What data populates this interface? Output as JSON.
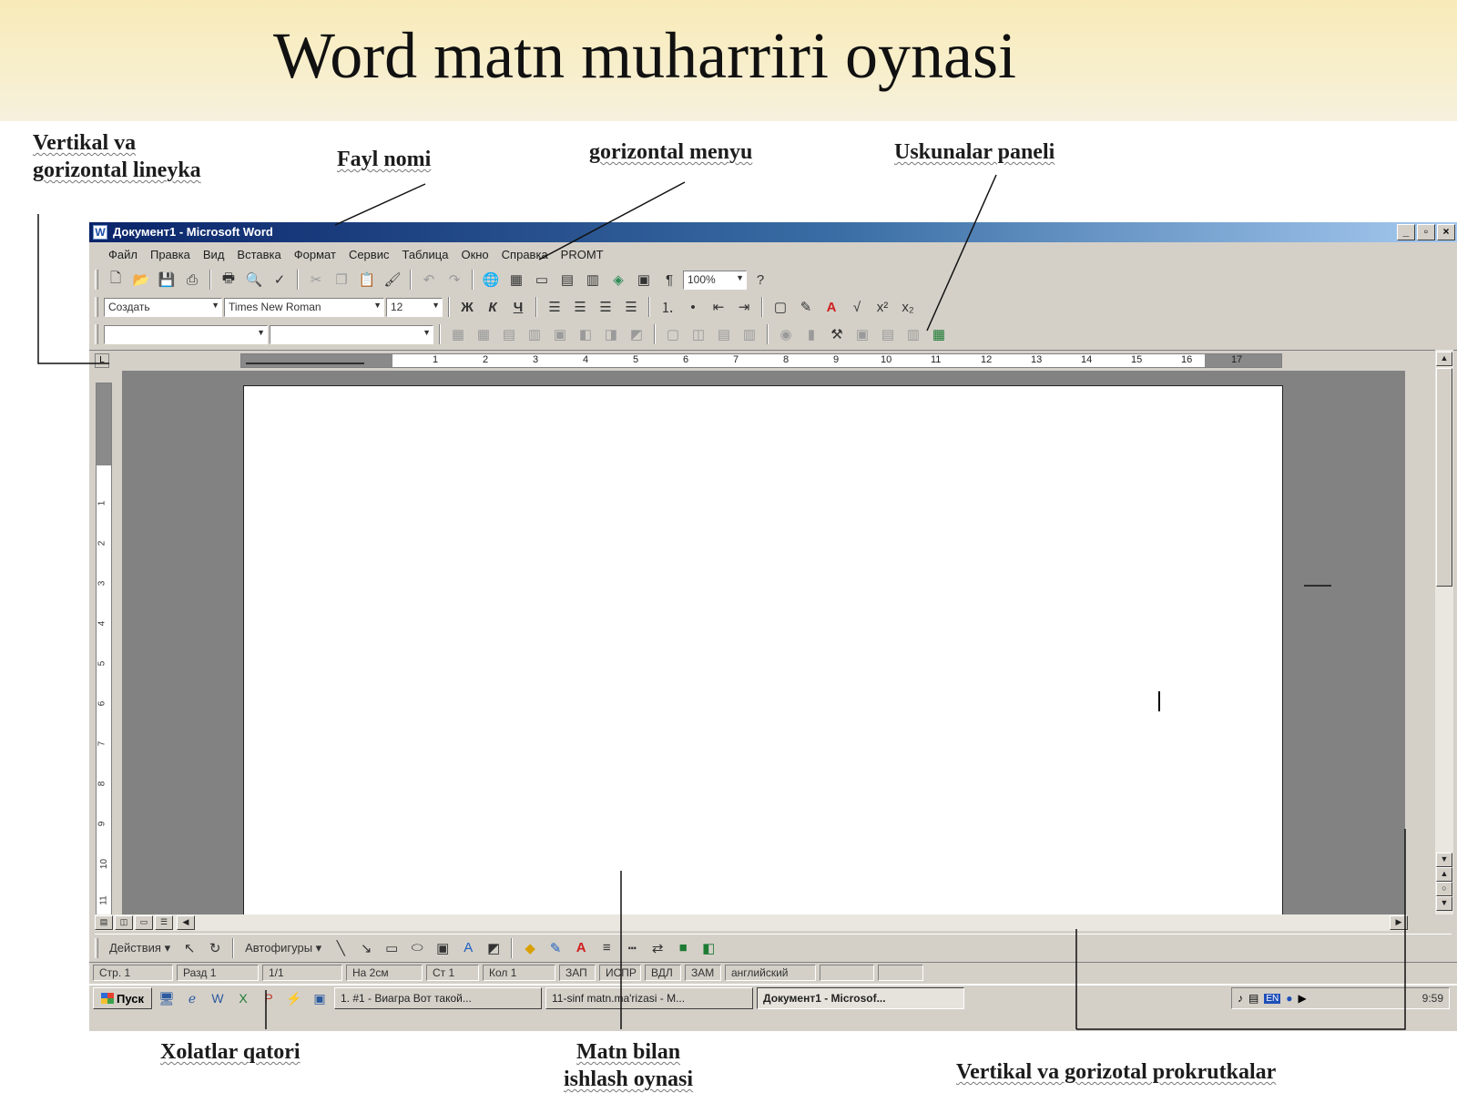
{
  "slide": {
    "title": "Word matn muharriri oynasi"
  },
  "callouts": {
    "rulers": "Vertikal va\ngorizontal lineyka",
    "file_name": "Fayl nomi",
    "menu": "gorizontal menyu",
    "toolbar": "Uskunalar paneli",
    "status": "Xolatlar  qatori",
    "text_area": "Matn bilan\nishlash oynasi",
    "scrollbars": "Vertikal va gorizotal prokrutkalar"
  },
  "window": {
    "title": "Документ1 - Microsoft Word",
    "controls": [
      "_",
      "▫",
      "×"
    ]
  },
  "menu": [
    "Файл",
    "Правка",
    "Вид",
    "Вставка",
    "Формат",
    "Сервис",
    "Таблица",
    "Окно",
    "Справка",
    "PROMT"
  ],
  "format_bar": {
    "style": "Создать",
    "font": "Times New Roman",
    "size": "12"
  },
  "standard_bar": {
    "zoom": "100%"
  },
  "ruler_numbers": [
    "1",
    "2",
    "3",
    "4",
    "5",
    "6",
    "7",
    "8",
    "9",
    "10",
    "11",
    "12",
    "13",
    "14",
    "15",
    "16",
    "17"
  ],
  "vruler_numbers": [
    "1",
    "2",
    "3",
    "4",
    "5",
    "6",
    "7",
    "8",
    "9",
    "10",
    "11"
  ],
  "drawing_bar": {
    "actions": "Действия ▾",
    "autoshapes": "Автофигуры ▾"
  },
  "status_bar": {
    "page": "Стр.  1",
    "section": "Разд  1",
    "pages": "1/1",
    "at": "На  2см",
    "line": "Ст  1",
    "col": "Кол  1",
    "rec": "ЗАП",
    "trk": "ИСПР",
    "ext": "ВДЛ",
    "ovr": "ЗАМ",
    "language": "английский"
  },
  "taskbar": {
    "start": "Пуск",
    "tasks": [
      "1. #1 - Виагра Вот такой...",
      "11-sinf matn.ma'rizasi - M...",
      "Документ1 - Microsof..."
    ],
    "clock": "9:59"
  }
}
